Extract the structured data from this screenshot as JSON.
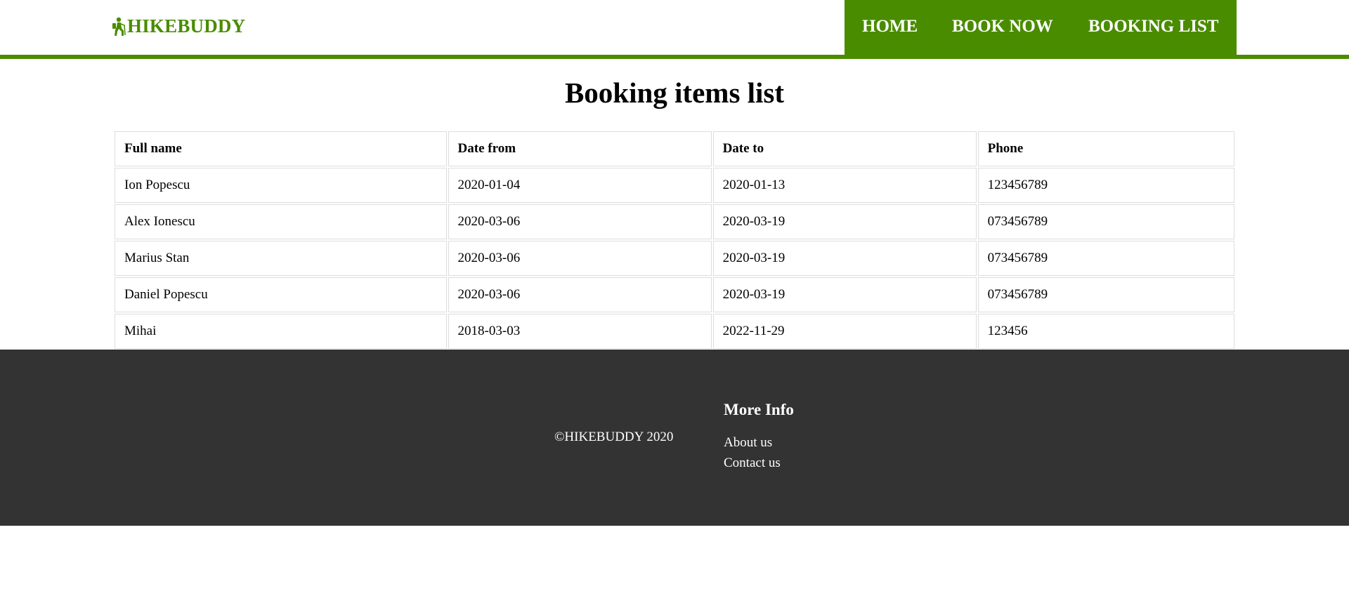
{
  "brand": {
    "name": "HIKEBUDDY",
    "icon": "hiker-icon",
    "color": "#4a8c00"
  },
  "nav": {
    "items": [
      {
        "label": "HOME"
      },
      {
        "label": "BOOK NOW"
      },
      {
        "label": "BOOKING LIST"
      }
    ],
    "background": "#4a8c00"
  },
  "main": {
    "title": "Booking items list",
    "table": {
      "headers": [
        "Full name",
        "Date from",
        "Date to",
        "Phone"
      ],
      "rows": [
        [
          "Ion Popescu",
          "2020-01-04",
          "2020-01-13",
          "123456789"
        ],
        [
          "Alex Ionescu",
          "2020-03-06",
          "2020-03-19",
          "073456789"
        ],
        [
          "Marius Stan",
          "2020-03-06",
          "2020-03-19",
          "073456789"
        ],
        [
          "Daniel Popescu",
          "2020-03-06",
          "2020-03-19",
          "073456789"
        ],
        [
          "Mihai",
          "2018-03-03",
          "2022-11-29",
          "123456"
        ]
      ]
    }
  },
  "footer": {
    "copyright": "©HIKEBUDDY 2020",
    "more_info_title": "More Info",
    "links": [
      {
        "label": "About us"
      },
      {
        "label": "Contact us"
      }
    ],
    "background": "#333333"
  }
}
